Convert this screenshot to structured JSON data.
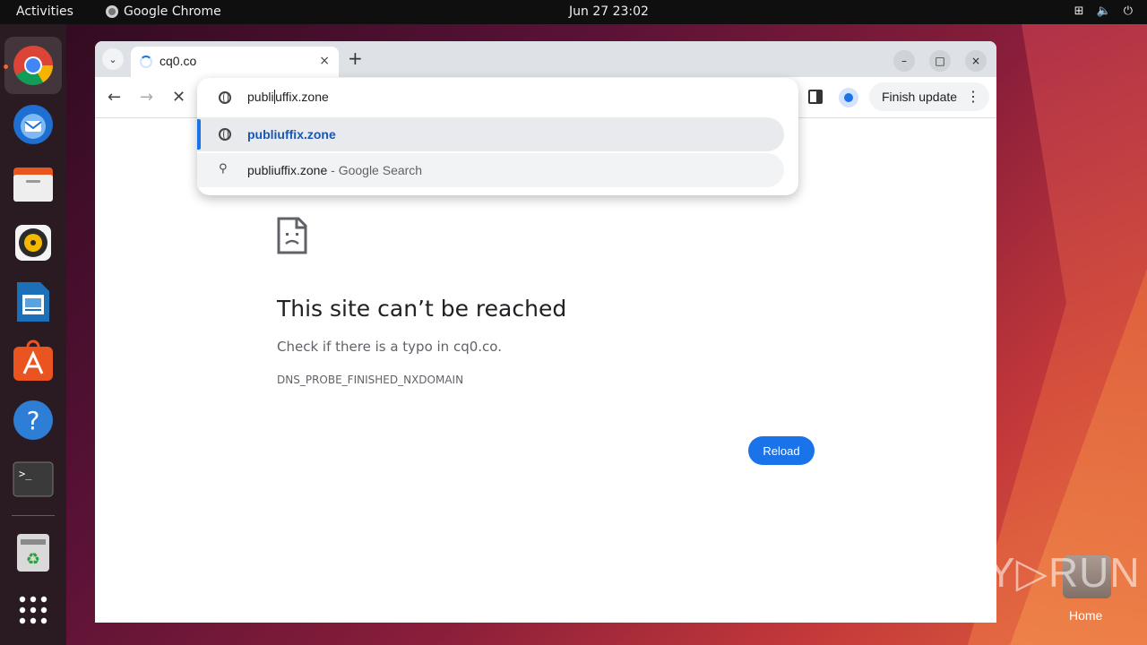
{
  "topbar": {
    "activities": "Activities",
    "app_name": "Google Chrome",
    "clock": "Jun 27  23:02",
    "tray_icons": [
      "network-icon",
      "volume-icon",
      "power-icon"
    ]
  },
  "dock": {
    "items": [
      "chrome-icon",
      "thunderbird-icon",
      "files-icon",
      "rhythmbox-icon",
      "writer-icon",
      "app-center-icon",
      "help-icon",
      "terminal-icon",
      "trash-icon",
      "show-apps-icon"
    ]
  },
  "browser": {
    "tab_title": "cq0.co",
    "tab_close": "×",
    "new_tab": "+",
    "window_buttons": {
      "minimize": "–",
      "maximize": "□",
      "close": "×"
    },
    "update_label": "Finish update",
    "update_menu": "⋮"
  },
  "omnibox": {
    "input_value_before_cursor": "publi",
    "input_value_after_cursor": "uffix.zone",
    "suggestions": [
      {
        "text": "publiuffix.zone",
        "suffix": ""
      },
      {
        "text": "publiuffix.zone",
        "suffix": " - Google Search"
      }
    ]
  },
  "page": {
    "title": "This site can’t be reached",
    "message": "Check if there is a typo in cq0.co.",
    "error_code": "DNS_PROBE_FINISHED_NXDOMAIN",
    "reload_label": "Reload"
  },
  "desktop": {
    "home_label": "Home",
    "watermark": "ANY▷RUN"
  },
  "colors": {
    "accent": "#1a73e8",
    "ubuntu_orange": "#e95420"
  }
}
